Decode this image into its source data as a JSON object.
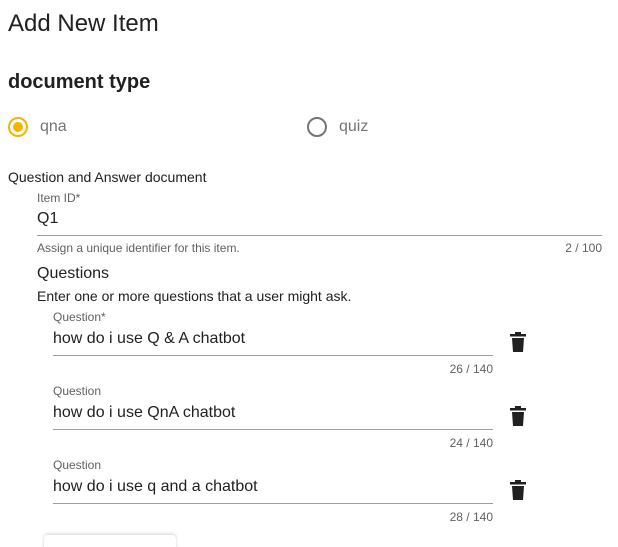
{
  "page": {
    "title": "Add New Item",
    "document_type_heading": "document type"
  },
  "document_type": {
    "options": [
      {
        "label": "qna",
        "selected": true
      },
      {
        "label": "quiz",
        "selected": false
      }
    ],
    "description": "Question and Answer document"
  },
  "item_id": {
    "label": "Item ID*",
    "value": "Q1",
    "hint": "Assign a unique identifier for this item.",
    "counter": "2 / 100"
  },
  "questions": {
    "heading": "Questions",
    "help": "Enter one or more questions that a user might ask.",
    "items": [
      {
        "label": "Question*",
        "value": "how do i use Q & A chatbot",
        "counter": "26 / 140",
        "delete_icon": "trash-icon"
      },
      {
        "label": "Question",
        "value": "how do i use QnA chatbot",
        "counter": "24 / 140",
        "delete_icon": "trash-icon"
      },
      {
        "label": "Question",
        "value": "how do i use q and a chatbot",
        "counter": "28 / 140",
        "delete_icon": "trash-icon"
      }
    ]
  },
  "colors": {
    "accent": "#f4b400",
    "text": "#212121",
    "secondary_text": "#616161",
    "radio_unselected": "#757575",
    "underline": "#9e9e9e"
  }
}
